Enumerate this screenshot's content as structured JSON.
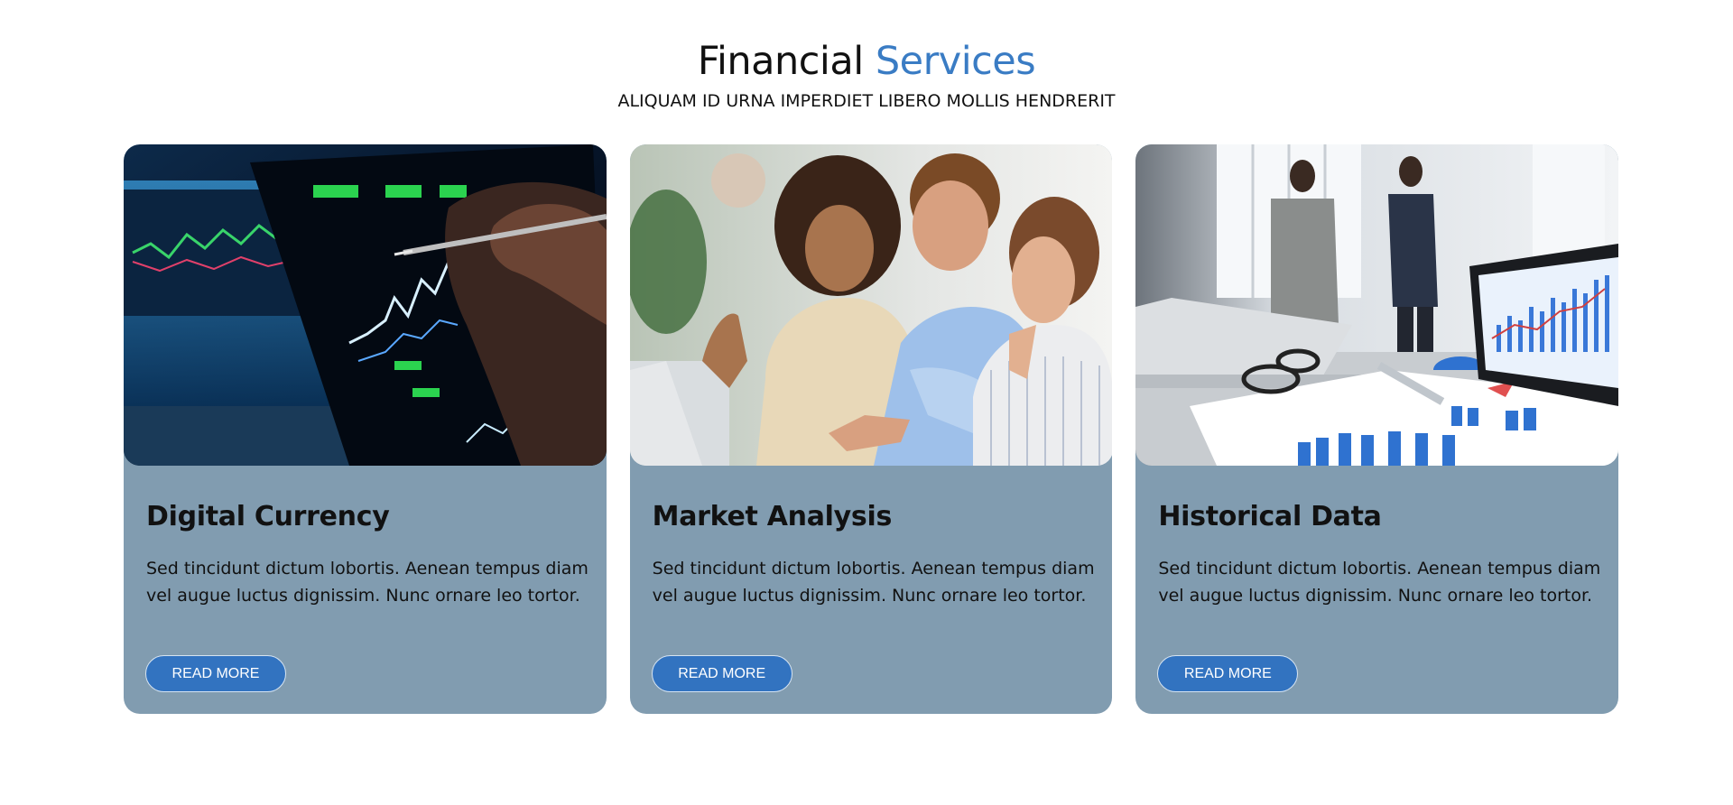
{
  "header": {
    "title_main": "Financial",
    "title_accent": "Services",
    "subtitle": "ALIQUAM ID URNA IMPERDIET LIBERO MOLLIS HENDRERIT"
  },
  "colors": {
    "accent": "#3a7cc4",
    "card_background": "#819cb0",
    "button": "#3273c0"
  },
  "cards": [
    {
      "title": "Digital Currency",
      "text": "Sed tincidunt dictum lobortis. Aenean tempus diam vel augue luctus dignissim. Nunc ornare leo tortor.",
      "button_label": "READ MORE",
      "image": "trading-screen-photo"
    },
    {
      "title": "Market Analysis",
      "text": "Sed tincidunt dictum lobortis. Aenean tempus diam vel augue luctus dignissim. Nunc ornare leo tortor.",
      "button_label": "READ MORE",
      "image": "team-meeting-photo"
    },
    {
      "title": "Historical Data",
      "text": "Sed tincidunt dictum lobortis. Aenean tempus diam vel augue luctus dignissim. Nunc ornare leo tortor.",
      "button_label": "READ MORE",
      "image": "office-charts-photo"
    }
  ]
}
